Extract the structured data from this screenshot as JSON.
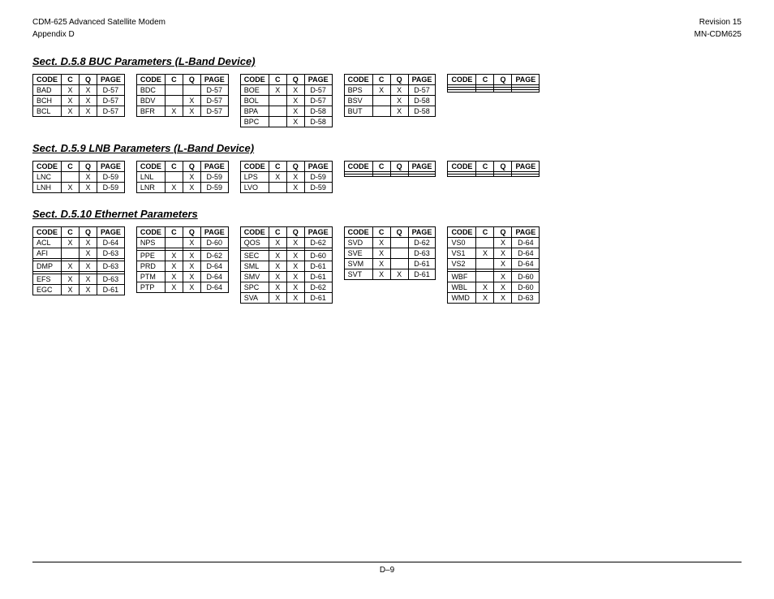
{
  "header": {
    "left_line1": "CDM-625 Advanced Satellite Modem",
    "left_line2": "Appendix D",
    "right_line1": "Revision 15",
    "right_line2": "MN-CDM625"
  },
  "footer": {
    "page": "D–9"
  },
  "sections": [
    {
      "id": "buc",
      "title": "Sect. D.5.8 BUC Parameters (L-Band Device)",
      "table_groups": [
        {
          "tables": [
            {
              "headers": [
                "CODE",
                "C",
                "Q",
                "PAGE"
              ],
              "rows": [
                [
                  "BAD",
                  "X",
                  "X",
                  "D-57"
                ],
                [
                  "BCH",
                  "X",
                  "X",
                  "D-57"
                ],
                [
                  "BCL",
                  "X",
                  "X",
                  "D-57"
                ]
              ]
            },
            {
              "headers": [
                "CODE",
                "C",
                "Q",
                "PAGE"
              ],
              "rows": [
                [
                  "BDC",
                  "",
                  "",
                  "D-57"
                ],
                [
                  "BDV",
                  "",
                  "X",
                  "D-57"
                ],
                [
                  "BFR",
                  "X",
                  "X",
                  "D-57"
                ]
              ]
            },
            {
              "headers": [
                "CODE",
                "C",
                "Q",
                "PAGE"
              ],
              "rows": [
                [
                  "BOE",
                  "X",
                  "X",
                  "D-57"
                ],
                [
                  "BOL",
                  "",
                  "X",
                  "D-57"
                ],
                [
                  "BPA",
                  "",
                  "X",
                  "D-58"
                ],
                [
                  "BPC",
                  "",
                  "X",
                  "D-58"
                ]
              ]
            },
            {
              "headers": [
                "CODE",
                "C",
                "Q",
                "PAGE"
              ],
              "rows": [
                [
                  "BPS",
                  "X",
                  "X",
                  "D-57"
                ],
                [
                  "BSV",
                  "",
                  "X",
                  "D-58"
                ],
                [
                  "BUT",
                  "",
                  "X",
                  "D-58"
                ]
              ]
            },
            {
              "headers": [
                "CODE",
                "C",
                "Q",
                "PAGE"
              ],
              "rows": [
                [
                  "",
                  "",
                  "",
                  ""
                ],
                [
                  "",
                  "",
                  "",
                  ""
                ],
                [
                  "",
                  "",
                  "",
                  ""
                ]
              ]
            }
          ]
        }
      ]
    },
    {
      "id": "lnb",
      "title": "Sect. D.5.9 LNB Parameters (L-Band Device)",
      "table_groups": [
        {
          "tables": [
            {
              "headers": [
                "CODE",
                "C",
                "Q",
                "PAGE"
              ],
              "rows": [
                [
                  "LNC",
                  "",
                  "X",
                  "D-59"
                ],
                [
                  "LNH",
                  "X",
                  "X",
                  "D-59"
                ]
              ]
            },
            {
              "headers": [
                "CODE",
                "C",
                "Q",
                "PAGE"
              ],
              "rows": [
                [
                  "LNL",
                  "",
                  "X",
                  "D-59"
                ],
                [
                  "LNR",
                  "X",
                  "X",
                  "D-59"
                ]
              ]
            },
            {
              "headers": [
                "CODE",
                "C",
                "Q",
                "PAGE"
              ],
              "rows": [
                [
                  "LPS",
                  "X",
                  "X",
                  "D-59"
                ],
                [
                  "LVO",
                  "",
                  "X",
                  "D-59"
                ]
              ]
            },
            {
              "headers": [
                "CODE",
                "C",
                "Q",
                "PAGE"
              ],
              "rows": [
                [
                  "",
                  "",
                  "",
                  ""
                ],
                [
                  "",
                  "",
                  "",
                  ""
                ]
              ]
            },
            {
              "headers": [
                "CODE",
                "C",
                "Q",
                "PAGE"
              ],
              "rows": [
                [
                  "",
                  "",
                  "",
                  ""
                ],
                [
                  "",
                  "",
                  "",
                  ""
                ]
              ]
            }
          ]
        }
      ]
    },
    {
      "id": "ethernet",
      "title": "Sect. D.5.10 Ethernet Parameters",
      "table_groups": [
        {
          "tables": [
            {
              "headers": [
                "CODE",
                "C",
                "Q",
                "PAGE"
              ],
              "rows": [
                [
                  "ACL",
                  "X",
                  "X",
                  "D-64"
                ],
                [
                  "AFI",
                  "",
                  "X",
                  "D-63"
                ],
                [
                  "",
                  "",
                  "",
                  ""
                ],
                [
                  "DMP",
                  "X",
                  "X",
                  "D-63"
                ],
                [
                  "",
                  "",
                  "",
                  ""
                ],
                [
                  "EFS",
                  "X",
                  "X",
                  "D-63"
                ],
                [
                  "EGC",
                  "X",
                  "X",
                  "D-61"
                ]
              ]
            },
            {
              "headers": [
                "CODE",
                "C",
                "Q",
                "PAGE"
              ],
              "rows": [
                [
                  "NPS",
                  "",
                  "X",
                  "D-60"
                ],
                [
                  "",
                  "",
                  "",
                  ""
                ],
                [
                  "PPE",
                  "X",
                  "X",
                  "D-62"
                ],
                [
                  "PRD",
                  "X",
                  "X",
                  "D-64"
                ],
                [
                  "PTM",
                  "X",
                  "X",
                  "D-64"
                ],
                [
                  "PTP",
                  "X",
                  "X",
                  "D-64"
                ]
              ]
            },
            {
              "headers": [
                "CODE",
                "C",
                "Q",
                "PAGE"
              ],
              "rows": [
                [
                  "QOS",
                  "X",
                  "X",
                  "D-62"
                ],
                [
                  "",
                  "",
                  "",
                  ""
                ],
                [
                  "SEC",
                  "X",
                  "X",
                  "D-60"
                ],
                [
                  "SML",
                  "X",
                  "X",
                  "D-61"
                ],
                [
                  "SMV",
                  "X",
                  "X",
                  "D-61"
                ],
                [
                  "SPC",
                  "X",
                  "X",
                  "D-62"
                ],
                [
                  "SVA",
                  "X",
                  "X",
                  "D-61"
                ]
              ]
            },
            {
              "headers": [
                "CODE",
                "C",
                "Q",
                "PAGE"
              ],
              "rows": [
                [
                  "SVD",
                  "X",
                  "",
                  "D-62"
                ],
                [
                  "SVE",
                  "X",
                  "",
                  "D-63"
                ],
                [
                  "SVM",
                  "X",
                  "",
                  "D-61"
                ],
                [
                  "SVT",
                  "X",
                  "X",
                  "D-61"
                ]
              ]
            },
            {
              "headers": [
                "CODE",
                "C",
                "Q",
                "PAGE"
              ],
              "rows": [
                [
                  "VS0",
                  "",
                  "X",
                  "D-64"
                ],
                [
                  "VS1",
                  "X",
                  "X",
                  "D-64"
                ],
                [
                  "VS2",
                  "",
                  "X",
                  "D-64"
                ],
                [
                  "",
                  "",
                  "",
                  ""
                ],
                [
                  "WBF",
                  "",
                  "X",
                  "D-60"
                ],
                [
                  "WBL",
                  "X",
                  "X",
                  "D-60"
                ],
                [
                  "WMD",
                  "X",
                  "X",
                  "D-63"
                ]
              ]
            }
          ]
        }
      ]
    }
  ]
}
